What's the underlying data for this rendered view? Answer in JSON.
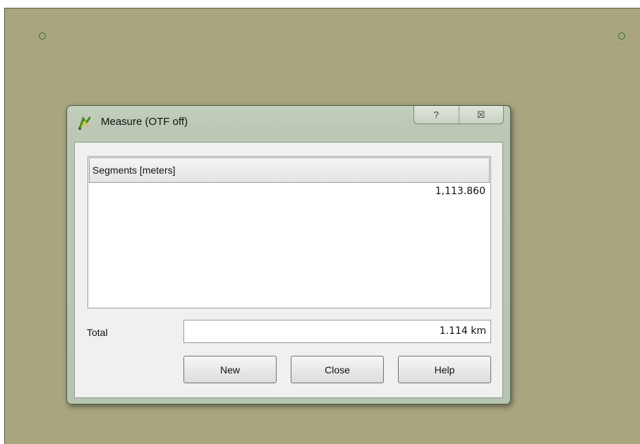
{
  "dialog": {
    "title": "Measure (OTF off)",
    "help_glyph": "?",
    "close_glyph": "☒",
    "segments_header": "Segments [meters]",
    "segments": [
      "1,113.860"
    ],
    "total_label": "Total",
    "total_value": "1.114 km",
    "buttons": {
      "new": "New",
      "close": "Close",
      "help": "Help"
    }
  },
  "icons": [
    "qgis-measure-icon",
    "help-icon",
    "close-icon"
  ],
  "colors": {
    "map_background": "#a8a57f",
    "vertex_stroke": "#2f6f2f",
    "dialog_frame": "#bcc8b5"
  }
}
